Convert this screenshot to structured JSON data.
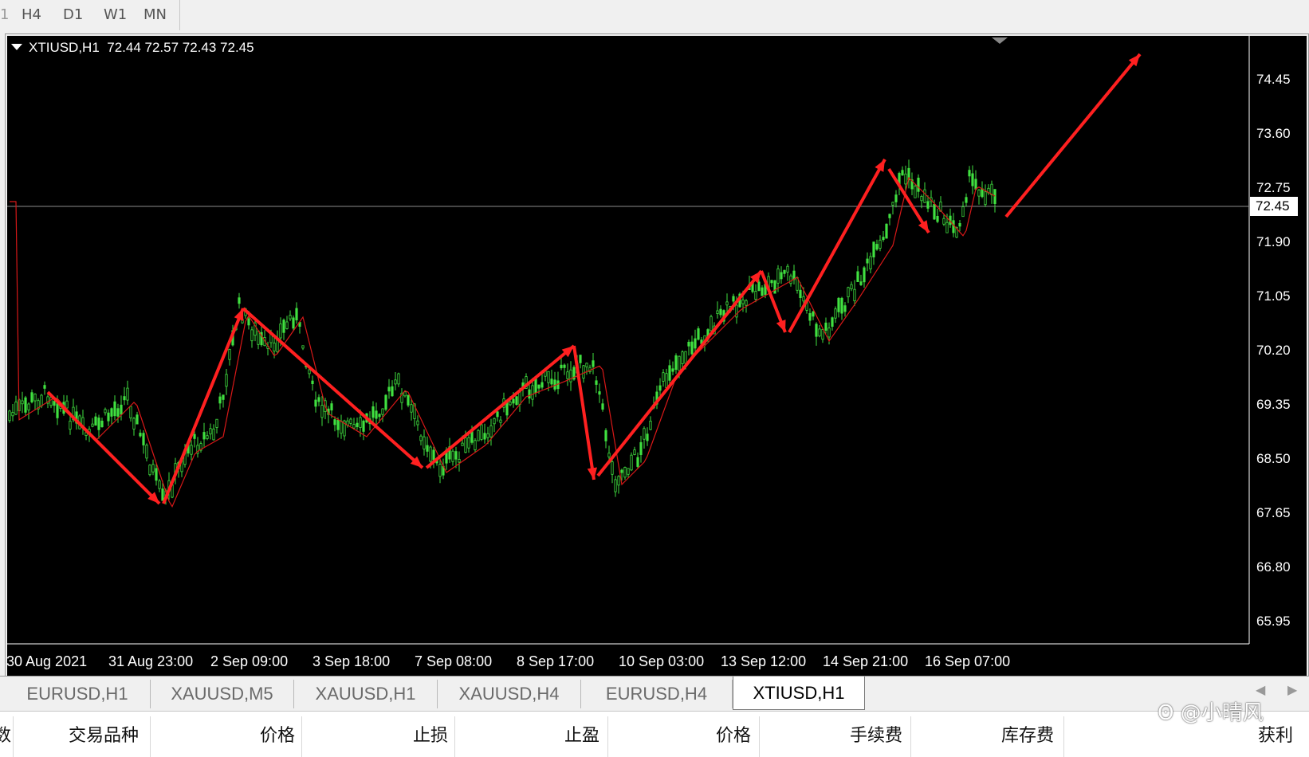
{
  "timeframes": [
    "H4",
    "D1",
    "W1",
    "MN"
  ],
  "chart": {
    "symbol_info": "XTIUSD,H1  72.44 72.57 72.43 72.45",
    "current_price": "72.45",
    "y_ticks": [
      "74.45",
      "73.60",
      "72.75",
      "71.90",
      "71.05",
      "70.20",
      "69.35",
      "68.50",
      "67.65",
      "66.80",
      "65.95"
    ],
    "x_ticks": [
      "30 Aug 2021",
      "31 Aug 23:00",
      "2 Sep 09:00",
      "3 Sep 18:00",
      "7 Sep 08:00",
      "8 Sep 17:00",
      "10 Sep 03:00",
      "13 Sep 12:00",
      "14 Sep 21:00",
      "16 Sep 07:00"
    ],
    "colors": {
      "background": "#000000",
      "candles": "#40e040",
      "moving_average": "#e02020",
      "arrows": "#ff2020",
      "price_line": "#a0a0a0"
    }
  },
  "tabs": [
    "EURUSD,H1",
    "XAUUSD,M5",
    "XAUUSD,H1",
    "XAUUSD,H4",
    "EURUSD,H4",
    "XTIUSD,H1"
  ],
  "active_tab": "XTIUSD,H1",
  "terminal": {
    "columns": [
      "数",
      "交易品种",
      "价格",
      "止损",
      "止盈",
      "价格",
      "手续费",
      "库存费",
      "获利"
    ]
  },
  "watermark": "@小晴风"
}
